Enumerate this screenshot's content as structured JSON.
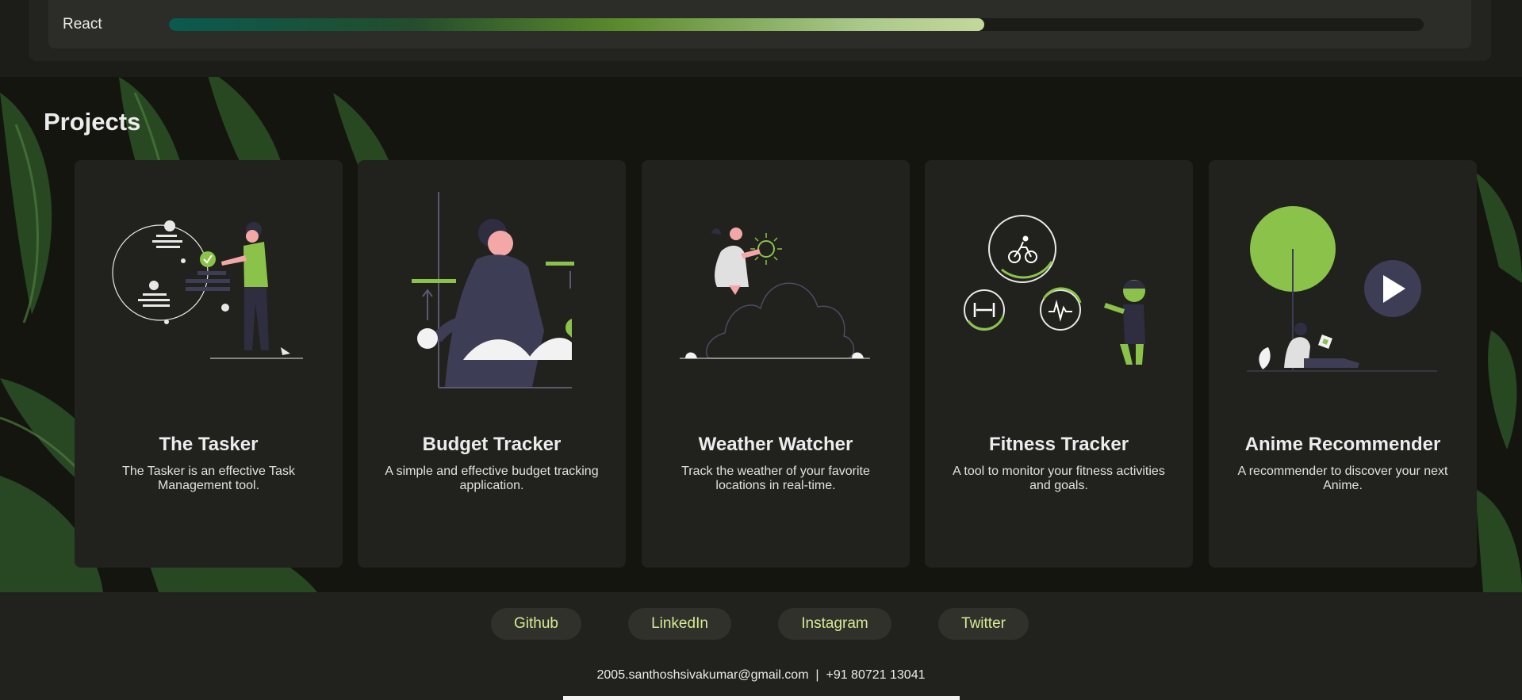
{
  "skills": {
    "items": [
      {
        "name": "React",
        "level_percent": 65
      }
    ]
  },
  "projects": {
    "title": "Projects",
    "cards": [
      {
        "title": "The Tasker",
        "description": "The Tasker is an effective Task Management tool."
      },
      {
        "title": "Budget Tracker",
        "description": "A simple and effective budget tracking application."
      },
      {
        "title": "Weather Watcher",
        "description": "Track the weather of your favorite locations in real-time."
      },
      {
        "title": "Fitness Tracker",
        "description": "A tool to monitor your fitness activities and goals."
      },
      {
        "title": "Anime Recommender",
        "description": "A recommender to discover your next Anime."
      }
    ]
  },
  "footer": {
    "links": [
      "Github",
      "LinkedIn",
      "Instagram",
      "Twitter"
    ],
    "contact": "2005.santhoshsivakumar@gmail.com  |  +91 80721 13041"
  },
  "colors": {
    "accent": "#8bc34a",
    "link_text": "#d5ea94",
    "card_bg": "#21221d",
    "page_bg": "#1c1d18"
  },
  "icons": [
    "task-illustration",
    "budget-illustration",
    "weather-illustration",
    "fitness-illustration",
    "anime-illustration",
    "bicycle-icon",
    "dumbbell-icon",
    "heartbeat-icon",
    "play-icon"
  ]
}
